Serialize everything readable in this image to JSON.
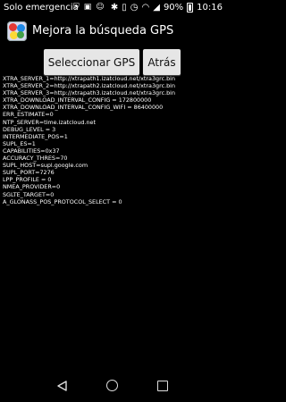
{
  "status_bar": {
    "carrier": "Solo emergencia",
    "battery": "90%",
    "time": "10:16"
  },
  "header": {
    "title": "Mejora la búsqueda GPS"
  },
  "buttons": {
    "select_gps": "Seleccionar GPS",
    "back": "Atrás"
  },
  "config_lines": [
    "XTRA_SERVER_1=http://xtrapath1.izatcloud.net/xtra3grc.bin",
    "XTRA_SERVER_2=http://xtrapath2.izatcloud.net/xtra3grc.bin",
    "XTRA_SERVER_3=http://xtrapath3.izatcloud.net/xtra3grc.bin",
    "XTRA_DOWNLOAD_INTERVAL_CONFIG = 172800000",
    "XTRA_DOWNLOAD_INTERVAL_CONFIG_WIFI = 86400000",
    "ERR_ESTIMATE=0",
    "NTP_SERVER=time.izatcloud.net",
    "DEBUG_LEVEL = 3",
    "INTERMEDIATE_POS=1",
    "SUPL_ES=1",
    "CAPABILITIES=0x37",
    "ACCURACY_THRES=70",
    "SUPL_HOST=supl.google.com",
    "SUPL_PORT=7276",
    "LPP_PROFILE = 0",
    "NMEA_PROVIDER=0",
    "SGLTE_TARGET=0",
    "A_GLONASS_POS_PROTOCOL_SELECT = 0"
  ]
}
